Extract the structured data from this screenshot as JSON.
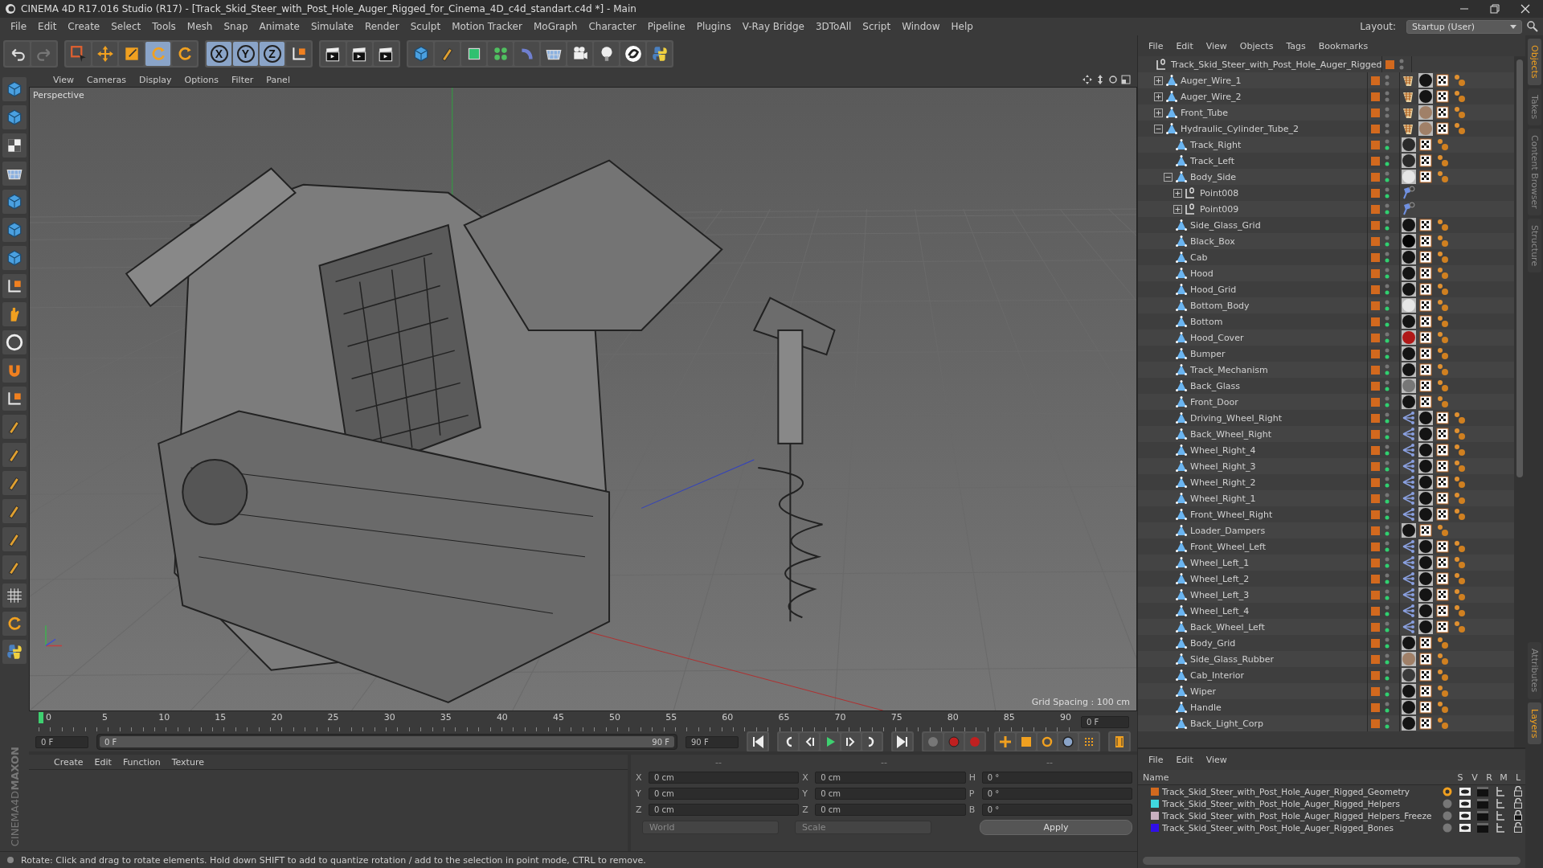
{
  "window": {
    "title": "CINEMA 4D R17.016 Studio (R17) - [Track_Skid_Steer_with_Post_Hole_Auger_Rigged_for_Cinema_4D_c4d_standart.c4d *] - Main"
  },
  "menu": [
    "File",
    "Edit",
    "Create",
    "Select",
    "Tools",
    "Mesh",
    "Snap",
    "Animate",
    "Simulate",
    "Render",
    "Sculpt",
    "Motion Tracker",
    "MoGraph",
    "Character",
    "Pipeline",
    "Plugins",
    "V-Ray Bridge",
    "3DToAll",
    "Script",
    "Window",
    "Help"
  ],
  "layout": {
    "label": "Layout:",
    "value": "Startup (User)"
  },
  "toolbar": [
    {
      "selected": false
    },
    {
      "selected": false
    },
    {
      "selected": false
    },
    {
      "selected": false
    },
    {
      "selected": false
    },
    {
      "selected": true
    },
    {
      "selected": false
    },
    {
      "label": "X",
      "selected": true
    },
    {
      "label": "Y",
      "selected": true
    },
    {
      "label": "Z",
      "selected": true
    },
    {
      "selected": false
    },
    {
      "selected": false
    },
    {
      "selected": false
    },
    {
      "selected": false
    },
    {
      "selected": false
    },
    {
      "selected": false
    },
    {
      "selected": false
    },
    {
      "selected": false
    },
    {
      "selected": false
    },
    {
      "selected": false
    },
    {
      "selected": false
    },
    {
      "selected": false
    },
    {
      "selected": false
    },
    {
      "selected": false
    }
  ],
  "logo": {
    "brand": "MAXON",
    "product": "CINEMA4D"
  },
  "viewport": {
    "menu": [
      "View",
      "Cameras",
      "Display",
      "Options",
      "Filter",
      "Panel"
    ],
    "camera": "Perspective",
    "grid_spacing": "Grid Spacing : 100 cm"
  },
  "timeline": {
    "ticks": [
      "0",
      "5",
      "10",
      "15",
      "20",
      "25",
      "30",
      "35",
      "40",
      "45",
      "50",
      "55",
      "60",
      "65",
      "70",
      "75",
      "80",
      "85",
      "90"
    ],
    "frame": "0 F",
    "start": "0 F",
    "range_start": "0 F",
    "range_end": "90 F",
    "level": 1,
    "end": "90 F"
  },
  "materials": {
    "menu": [
      "Create",
      "Edit",
      "Function",
      "Texture"
    ]
  },
  "coordinates": {
    "headers": [
      "--",
      "--",
      "--"
    ],
    "rows": [
      {
        "axis": "X",
        "position": "0 cm",
        "size_axis": "X",
        "size": "0 cm",
        "rotation_axis": "H",
        "rotation": "0 °"
      },
      {
        "axis": "Y",
        "position": "0 cm",
        "size_axis": "Y",
        "size": "0 cm",
        "rotation_axis": "P",
        "rotation": "0 °"
      },
      {
        "axis": "Z",
        "position": "0 cm",
        "size_axis": "Z",
        "size": "0 cm",
        "rotation_axis": "B",
        "rotation": "0 °"
      }
    ],
    "mode": "World",
    "transform": "Scale",
    "apply": "Apply"
  },
  "status_bar": "Rotate: Click and drag to rotate elements. Hold down SHIFT to add to quantize rotation / add to the selection in point mode, CTRL to remove.",
  "objects_panel": {
    "menu": [
      "File",
      "Edit",
      "View",
      "Objects",
      "Tags",
      "Bookmarks"
    ],
    "objects": [
      {
        "name": "Track_Skid_Steer_with_Post_Hole_Auger_Rigged",
        "kind": "null",
        "enabled": false,
        "children": [
          {
            "name": "Auger_Wire_1",
            "kind": "polygon",
            "expanded": false,
            "enabled": false,
            "tags": [
              {
                "kind": "weight"
              },
              {
                "kind": "material",
                "color": "#141414"
              },
              {
                "kind": "uvw"
              },
              {
                "kind": "ik"
              }
            ]
          },
          {
            "name": "Auger_Wire_2",
            "kind": "polygon",
            "expanded": false,
            "enabled": false,
            "tags": [
              {
                "kind": "weight"
              },
              {
                "kind": "material",
                "color": "#141414"
              },
              {
                "kind": "uvw"
              },
              {
                "kind": "ik"
              }
            ]
          },
          {
            "name": "Front_Tube",
            "kind": "polygon",
            "expanded": false,
            "enabled": false,
            "tags": [
              {
                "kind": "weight"
              },
              {
                "kind": "material",
                "color": "#a08068"
              },
              {
                "kind": "uvw"
              },
              {
                "kind": "ik"
              }
            ]
          },
          {
            "name": "Hydraulic_Cylinder_Tube_2",
            "kind": "polygon",
            "expanded": true,
            "enabled": false,
            "tags": [
              {
                "kind": "weight"
              },
              {
                "kind": "material",
                "color": "#a08068"
              },
              {
                "kind": "uvw"
              },
              {
                "kind": "ik"
              }
            ],
            "children": [
              {
                "name": "Track_Right",
                "kind": "polygon",
                "enabled": true,
                "tags": [
                  {
                    "kind": "material",
                    "color": "#2a2a2a"
                  },
                  {
                    "kind": "uvw"
                  },
                  {
                    "kind": "ik"
                  }
                ]
              },
              {
                "name": "Track_Left",
                "kind": "polygon",
                "enabled": true,
                "tags": [
                  {
                    "kind": "material",
                    "color": "#2a2a2a"
                  },
                  {
                    "kind": "uvw"
                  },
                  {
                    "kind": "ik"
                  }
                ]
              },
              {
                "name": "Body_Side",
                "kind": "polygon",
                "expanded": true,
                "enabled": true,
                "tags": [
                  {
                    "kind": "material",
                    "color": "#e6e6e6"
                  },
                  {
                    "kind": "uvw"
                  },
                  {
                    "kind": "ik"
                  }
                ],
                "children": [
                  {
                    "name": "Point008",
                    "kind": "null",
                    "expanded": false,
                    "enabled": true,
                    "tags": [
                      {
                        "kind": "pin"
                      }
                    ]
                  },
                  {
                    "name": "Point009",
                    "kind": "null",
                    "expanded": false,
                    "enabled": true,
                    "tags": [
                      {
                        "kind": "pin"
                      }
                    ]
                  }
                ]
              },
              {
                "name": "Side_Glass_Grid",
                "kind": "polygon",
                "enabled": true,
                "tags": [
                  {
                    "kind": "material",
                    "color": "#141414"
                  },
                  {
                    "kind": "uvw"
                  },
                  {
                    "kind": "ik"
                  }
                ]
              },
              {
                "name": "Black_Box",
                "kind": "polygon",
                "enabled": true,
                "tags": [
                  {
                    "kind": "material",
                    "color": "#050505"
                  },
                  {
                    "kind": "uvw"
                  },
                  {
                    "kind": "ik"
                  }
                ]
              },
              {
                "name": "Cab",
                "kind": "polygon",
                "enabled": true,
                "tags": [
                  {
                    "kind": "material",
                    "color": "#141414"
                  },
                  {
                    "kind": "uvw"
                  },
                  {
                    "kind": "ik"
                  }
                ]
              },
              {
                "name": "Hood",
                "kind": "polygon",
                "enabled": true,
                "tags": [
                  {
                    "kind": "material",
                    "color": "#141414"
                  },
                  {
                    "kind": "uvw"
                  },
                  {
                    "kind": "ik"
                  }
                ]
              },
              {
                "name": "Hood_Grid",
                "kind": "polygon",
                "enabled": true,
                "tags": [
                  {
                    "kind": "material",
                    "color": "#141414"
                  },
                  {
                    "kind": "uvw"
                  },
                  {
                    "kind": "ik"
                  }
                ]
              },
              {
                "name": "Bottom_Body",
                "kind": "polygon",
                "enabled": true,
                "tags": [
                  {
                    "kind": "material",
                    "color": "#e6e6e6"
                  },
                  {
                    "kind": "uvw"
                  },
                  {
                    "kind": "ik"
                  }
                ]
              },
              {
                "name": "Bottom",
                "kind": "polygon",
                "enabled": true,
                "tags": [
                  {
                    "kind": "material",
                    "color": "#141414"
                  },
                  {
                    "kind": "uvw"
                  },
                  {
                    "kind": "ik"
                  }
                ]
              },
              {
                "name": "Hood_Cover",
                "kind": "polygon",
                "enabled": true,
                "tags": [
                  {
                    "kind": "material",
                    "color": "#b01818"
                  },
                  {
                    "kind": "uvw"
                  },
                  {
                    "kind": "ik"
                  }
                ]
              },
              {
                "name": "Bumper",
                "kind": "polygon",
                "enabled": true,
                "tags": [
                  {
                    "kind": "material",
                    "color": "#141414"
                  },
                  {
                    "kind": "uvw"
                  },
                  {
                    "kind": "ik"
                  }
                ]
              },
              {
                "name": "Track_Mechanism",
                "kind": "polygon",
                "enabled": true,
                "tags": [
                  {
                    "kind": "material",
                    "color": "#141414"
                  },
                  {
                    "kind": "uvw"
                  },
                  {
                    "kind": "ik"
                  }
                ]
              },
              {
                "name": "Back_Glass",
                "kind": "polygon",
                "enabled": true,
                "tags": [
                  {
                    "kind": "material",
                    "color": "#777777"
                  },
                  {
                    "kind": "uvw"
                  },
                  {
                    "kind": "ik"
                  }
                ]
              },
              {
                "name": "Front_Door",
                "kind": "polygon",
                "enabled": true,
                "tags": [
                  {
                    "kind": "material",
                    "color": "#141414"
                  },
                  {
                    "kind": "uvw"
                  },
                  {
                    "kind": "ik"
                  }
                ]
              },
              {
                "name": "Driving_Wheel_Right",
                "kind": "polygon",
                "enabled": true,
                "tags": [
                  {
                    "kind": "skin"
                  },
                  {
                    "kind": "material",
                    "color": "#141414"
                  },
                  {
                    "kind": "uvw"
                  },
                  {
                    "kind": "ik"
                  }
                ]
              },
              {
                "name": "Back_Wheel_Right",
                "kind": "polygon",
                "enabled": true,
                "tags": [
                  {
                    "kind": "skin"
                  },
                  {
                    "kind": "material",
                    "color": "#141414"
                  },
                  {
                    "kind": "uvw"
                  },
                  {
                    "kind": "ik"
                  }
                ]
              },
              {
                "name": "Wheel_Right_4",
                "kind": "polygon",
                "enabled": true,
                "tags": [
                  {
                    "kind": "skin"
                  },
                  {
                    "kind": "material",
                    "color": "#141414"
                  },
                  {
                    "kind": "uvw"
                  },
                  {
                    "kind": "ik"
                  }
                ]
              },
              {
                "name": "Wheel_Right_3",
                "kind": "polygon",
                "enabled": true,
                "tags": [
                  {
                    "kind": "skin"
                  },
                  {
                    "kind": "material",
                    "color": "#141414"
                  },
                  {
                    "kind": "uvw"
                  },
                  {
                    "kind": "ik"
                  }
                ]
              },
              {
                "name": "Wheel_Right_2",
                "kind": "polygon",
                "enabled": true,
                "tags": [
                  {
                    "kind": "skin"
                  },
                  {
                    "kind": "material",
                    "color": "#141414"
                  },
                  {
                    "kind": "uvw"
                  },
                  {
                    "kind": "ik"
                  }
                ]
              },
              {
                "name": "Wheel_Right_1",
                "kind": "polygon",
                "enabled": true,
                "tags": [
                  {
                    "kind": "skin"
                  },
                  {
                    "kind": "material",
                    "color": "#141414"
                  },
                  {
                    "kind": "uvw"
                  },
                  {
                    "kind": "ik"
                  }
                ]
              },
              {
                "name": "Front_Wheel_Right",
                "kind": "polygon",
                "enabled": true,
                "tags": [
                  {
                    "kind": "skin"
                  },
                  {
                    "kind": "material",
                    "color": "#141414"
                  },
                  {
                    "kind": "uvw"
                  },
                  {
                    "kind": "ik"
                  }
                ]
              },
              {
                "name": "Loader_Dampers",
                "kind": "polygon",
                "enabled": true,
                "tags": [
                  {
                    "kind": "material",
                    "color": "#141414"
                  },
                  {
                    "kind": "uvw"
                  },
                  {
                    "kind": "ik"
                  }
                ]
              },
              {
                "name": "Front_Wheel_Left",
                "kind": "polygon",
                "enabled": true,
                "tags": [
                  {
                    "kind": "skin"
                  },
                  {
                    "kind": "material",
                    "color": "#141414"
                  },
                  {
                    "kind": "uvw"
                  },
                  {
                    "kind": "ik"
                  }
                ]
              },
              {
                "name": "Wheel_Left_1",
                "kind": "polygon",
                "enabled": true,
                "tags": [
                  {
                    "kind": "skin"
                  },
                  {
                    "kind": "material",
                    "color": "#141414"
                  },
                  {
                    "kind": "uvw"
                  },
                  {
                    "kind": "ik"
                  }
                ]
              },
              {
                "name": "Wheel_Left_2",
                "kind": "polygon",
                "enabled": true,
                "tags": [
                  {
                    "kind": "skin"
                  },
                  {
                    "kind": "material",
                    "color": "#141414"
                  },
                  {
                    "kind": "uvw"
                  },
                  {
                    "kind": "ik"
                  }
                ]
              },
              {
                "name": "Wheel_Left_3",
                "kind": "polygon",
                "enabled": true,
                "tags": [
                  {
                    "kind": "skin"
                  },
                  {
                    "kind": "material",
                    "color": "#141414"
                  },
                  {
                    "kind": "uvw"
                  },
                  {
                    "kind": "ik"
                  }
                ]
              },
              {
                "name": "Wheel_Left_4",
                "kind": "polygon",
                "enabled": true,
                "tags": [
                  {
                    "kind": "skin"
                  },
                  {
                    "kind": "material",
                    "color": "#141414"
                  },
                  {
                    "kind": "uvw"
                  },
                  {
                    "kind": "ik"
                  }
                ]
              },
              {
                "name": "Back_Wheel_Left",
                "kind": "polygon",
                "enabled": true,
                "tags": [
                  {
                    "kind": "skin"
                  },
                  {
                    "kind": "material",
                    "color": "#141414"
                  },
                  {
                    "kind": "uvw"
                  },
                  {
                    "kind": "ik"
                  }
                ]
              },
              {
                "name": "Body_Grid",
                "kind": "polygon",
                "enabled": true,
                "tags": [
                  {
                    "kind": "material",
                    "color": "#141414"
                  },
                  {
                    "kind": "uvw"
                  },
                  {
                    "kind": "ik"
                  }
                ]
              },
              {
                "name": "Side_Glass_Rubber",
                "kind": "polygon",
                "enabled": true,
                "tags": [
                  {
                    "kind": "material",
                    "color": "#a08068"
                  },
                  {
                    "kind": "uvw"
                  },
                  {
                    "kind": "ik"
                  }
                ]
              },
              {
                "name": "Cab_Interior",
                "kind": "polygon",
                "enabled": true,
                "tags": [
                  {
                    "kind": "material",
                    "color": "#3a3a3a"
                  },
                  {
                    "kind": "uvw"
                  },
                  {
                    "kind": "ik"
                  }
                ]
              },
              {
                "name": "Wiper",
                "kind": "polygon",
                "enabled": true,
                "tags": [
                  {
                    "kind": "material",
                    "color": "#141414"
                  },
                  {
                    "kind": "uvw"
                  },
                  {
                    "kind": "ik"
                  }
                ]
              },
              {
                "name": "Handle",
                "kind": "polygon",
                "enabled": true,
                "tags": [
                  {
                    "kind": "material",
                    "color": "#141414"
                  },
                  {
                    "kind": "uvw"
                  },
                  {
                    "kind": "ik"
                  }
                ]
              },
              {
                "name": "Back_Light_Corp",
                "kind": "polygon",
                "enabled": true,
                "tags": [
                  {
                    "kind": "material",
                    "color": "#141414"
                  },
                  {
                    "kind": "uvw"
                  },
                  {
                    "kind": "ik"
                  }
                ]
              }
            ]
          }
        ]
      }
    ]
  },
  "side_tabs_top": [
    {
      "label": "Objects",
      "selected": true
    },
    {
      "label": "Takes",
      "selected": false
    },
    {
      "label": "Content Browser",
      "selected": false
    },
    {
      "label": "Structure",
      "selected": false
    }
  ],
  "layers_panel": {
    "menu": [
      "File",
      "Edit",
      "View"
    ],
    "columns": [
      "Name",
      "S",
      "V",
      "R",
      "M",
      "L"
    ],
    "layers": [
      {
        "name": "Track_Skid_Steer_with_Post_Hole_Auger_Rigged_Geometry",
        "color": "#d2691e",
        "solo": true,
        "locked": false
      },
      {
        "name": "Track_Skid_Steer_with_Post_Hole_Auger_Rigged_Helpers",
        "color": "#40d8e0",
        "solo": false,
        "locked": false
      },
      {
        "name": "Track_Skid_Steer_with_Post_Hole_Auger_Rigged_Helpers_Freeze",
        "color": "#c8b0c0",
        "solo": false,
        "locked": true
      },
      {
        "name": "Track_Skid_Steer_with_Post_Hole_Auger_Rigged_Bones",
        "color": "#3010e8",
        "solo": false,
        "locked": false
      }
    ]
  },
  "side_tabs_bottom": [
    {
      "label": "Attributes",
      "selected": false
    },
    {
      "label": "Layers",
      "selected": true
    }
  ]
}
